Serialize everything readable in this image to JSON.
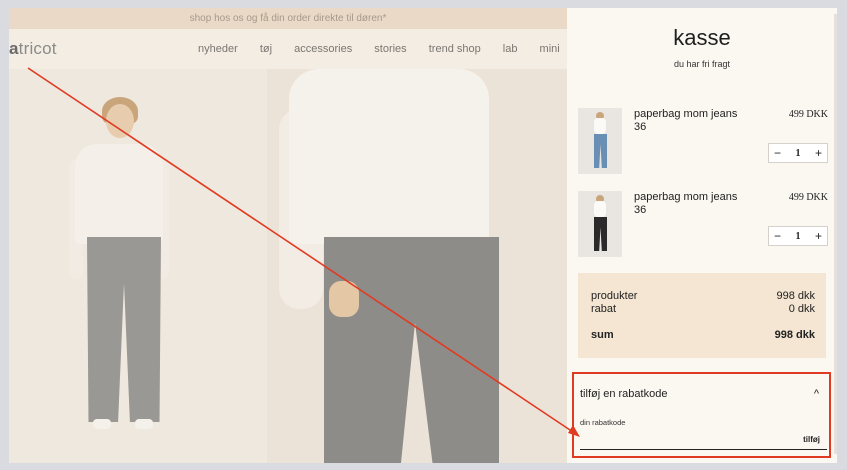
{
  "announcement": "shop hos os og få din order direkte til døren*",
  "brand": {
    "bold": "a",
    "rest": "tricot"
  },
  "nav": [
    "nyheder",
    "tøj",
    "accessories",
    "stories",
    "trend shop",
    "lab",
    "mini"
  ],
  "cart": {
    "title": "kasse",
    "subtitle": "du har fri fragt",
    "items": [
      {
        "name": "paperbag mom jeans",
        "size": "36",
        "price": "499 DKK",
        "qty": "1",
        "color": "blue"
      },
      {
        "name": "paperbag mom jeans",
        "size": "36",
        "price": "499 DKK",
        "qty": "1",
        "color": "black"
      }
    ],
    "summary": {
      "products_label": "produkter",
      "products_value": "998 dkk",
      "discount_label": "rabat",
      "discount_value": "0 dkk",
      "total_label": "sum",
      "total_value": "998 dkk"
    },
    "coupon": {
      "heading": "tilføj en rabatkode",
      "label": "din rabatkode",
      "value": "",
      "apply_label": "tilføj"
    }
  },
  "icons": {
    "minus": "minus-icon",
    "plus": "plus-icon",
    "chevron": "chevron-up-icon"
  },
  "colors": {
    "highlight": "#e13a22",
    "summary_bg": "#f4e6d2"
  }
}
